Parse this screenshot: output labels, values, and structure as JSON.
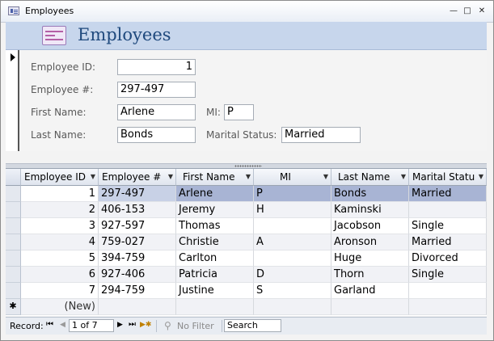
{
  "window": {
    "title": "Employees",
    "min": "—",
    "max": "□",
    "close": "✕"
  },
  "form": {
    "title": "Employees",
    "fields": {
      "employee_id": {
        "label": "Employee ID:",
        "value": "1"
      },
      "employee_num": {
        "label": "Employee #:",
        "value": "297-497"
      },
      "first_name": {
        "label": "First Name:",
        "value": "Arlene"
      },
      "mi": {
        "label": "MI:",
        "value": "P"
      },
      "last_name": {
        "label": "Last Name:",
        "value": "Bonds"
      },
      "marital_status": {
        "label": "Marital Status:",
        "value": "Married"
      }
    }
  },
  "datasheet": {
    "columns": [
      "Employee ID",
      "Employee #",
      "First Name",
      "MI",
      "Last Name",
      "Marital Statu"
    ],
    "rows": [
      [
        "1",
        "297-497",
        "Arlene",
        "P",
        "Bonds",
        "Married"
      ],
      [
        "2",
        "406-153",
        "Jeremy",
        "H",
        "Kaminski",
        ""
      ],
      [
        "3",
        "927-597",
        "Thomas",
        "",
        "Jacobson",
        "Single"
      ],
      [
        "4",
        "759-027",
        "Christie",
        "A",
        "Aronson",
        "Married"
      ],
      [
        "5",
        "394-759",
        "Carlton",
        "",
        "Huge",
        "Divorced"
      ],
      [
        "6",
        "927-406",
        "Patricia",
        "D",
        "Thorn",
        "Single"
      ],
      [
        "7",
        "294-759",
        "Justine",
        "S",
        "Garland",
        ""
      ]
    ],
    "new_row_marker": "✱",
    "new_row_label": "(New)"
  },
  "navigation": {
    "record_label": "Record:",
    "first": "⏮",
    "prev": "◀",
    "position": "1 of 7",
    "next": "▶",
    "last": "⏭",
    "new_record": "▶✱",
    "filter_icon": "⚲",
    "filter_label": "No Filter",
    "search_placeholder": "Search"
  }
}
